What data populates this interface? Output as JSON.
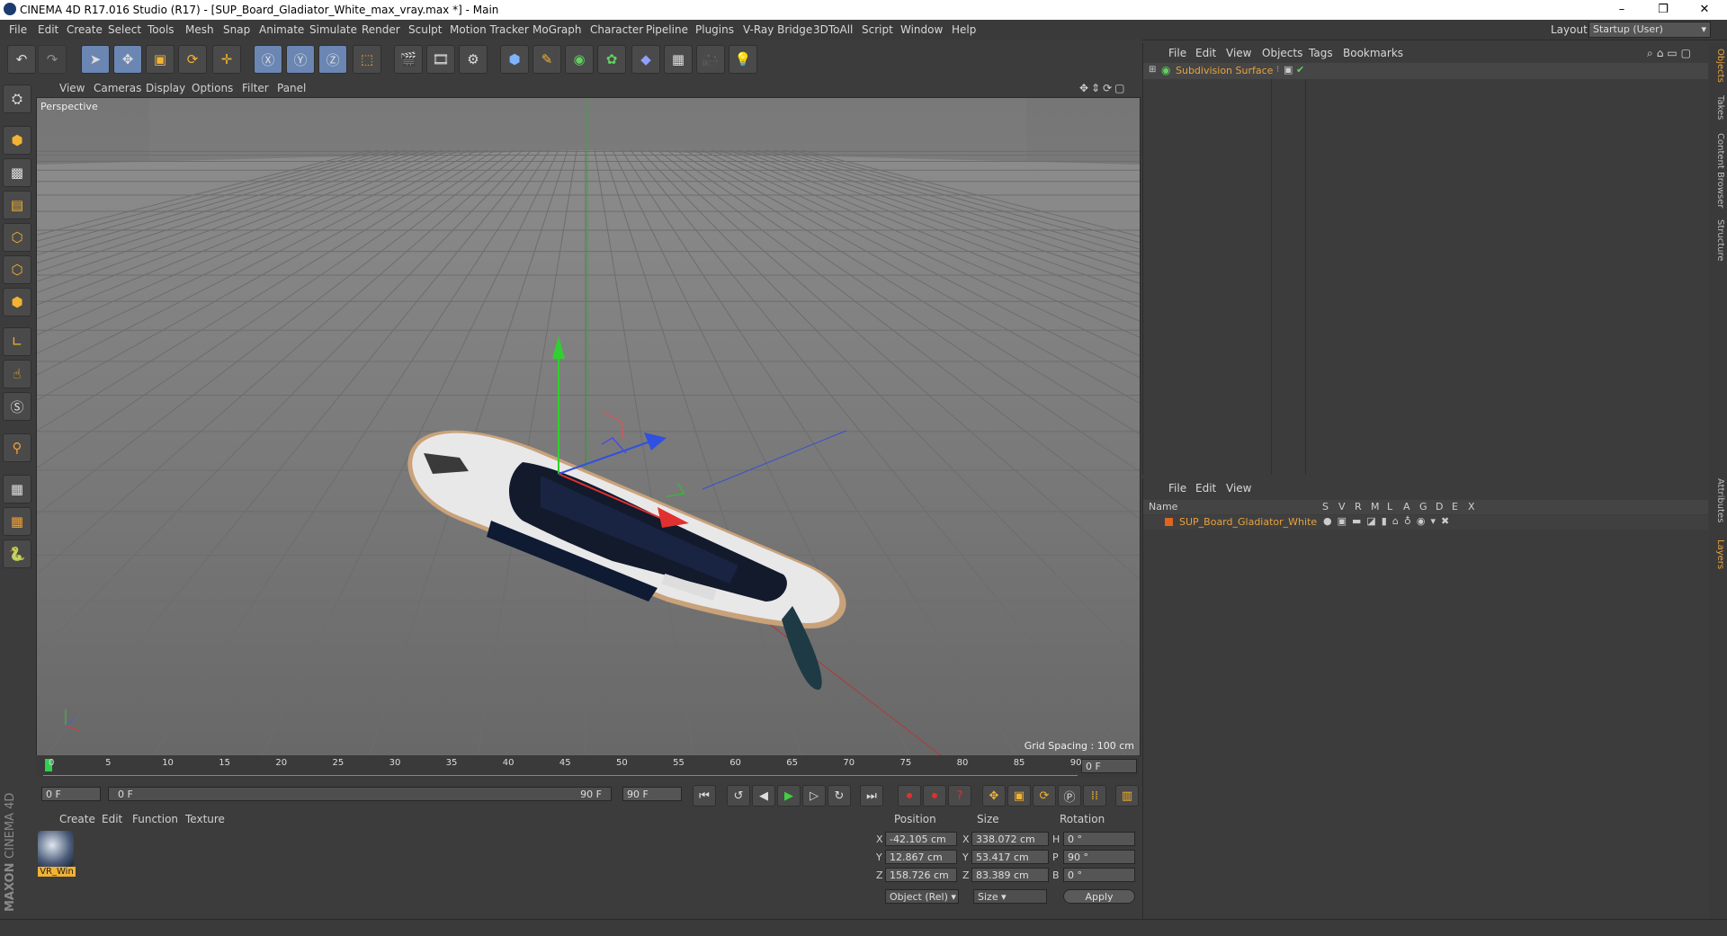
{
  "window": {
    "title": "CINEMA 4D R17.016 Studio (R17) - [SUP_Board_Gladiator_White_max_vray.max *] - Main",
    "controls": [
      "–",
      "❐",
      "✕"
    ]
  },
  "menu": [
    "File",
    "Edit",
    "Create",
    "Select",
    "Tools",
    "Mesh",
    "Snap",
    "Animate",
    "Simulate",
    "Render",
    "Sculpt",
    "Motion Tracker",
    "MoGraph",
    "Character",
    "Pipeline",
    "Plugins",
    "V-Ray Bridge",
    "3DToAll",
    "Script",
    "Window",
    "Help"
  ],
  "layout": {
    "label": "Layout:",
    "value": "Startup (User)"
  },
  "viewport": {
    "menu": [
      "View",
      "Cameras",
      "Display",
      "Options",
      "Filter",
      "Panel"
    ],
    "name": "Perspective",
    "grid_spacing": "Grid Spacing : 100 cm"
  },
  "timeline": {
    "ticks": [
      "0",
      "5",
      "10",
      "15",
      "20",
      "25",
      "30",
      "35",
      "40",
      "45",
      "50",
      "55",
      "60",
      "65",
      "70",
      "75",
      "80",
      "85",
      "90"
    ],
    "end_field": "0 F",
    "current": "0 F",
    "range_start": "0 F",
    "range_end": "90 F",
    "max": "90 F"
  },
  "material_manager": {
    "menu": [
      "Create",
      "Edit",
      "Function",
      "Texture"
    ],
    "materials": [
      {
        "name": "VR_Win"
      }
    ]
  },
  "coordinates": {
    "headers": [
      "Position",
      "Size",
      "Rotation"
    ],
    "rows": [
      {
        "axis": "X",
        "pos": "-42.105 cm",
        "size_axis": "X",
        "size": "338.072 cm",
        "rot_axis": "H",
        "rot": "0 °"
      },
      {
        "axis": "Y",
        "pos": "12.867 cm",
        "size_axis": "Y",
        "size": "53.417 cm",
        "rot_axis": "P",
        "rot": "90 °"
      },
      {
        "axis": "Z",
        "pos": "158.726 cm",
        "size_axis": "Z",
        "size": "83.389 cm",
        "rot_axis": "B",
        "rot": "0 °"
      }
    ],
    "mode": "Object (Rel)",
    "size_mode": "Size",
    "apply": "Apply"
  },
  "object_manager": {
    "menu": [
      "File",
      "Edit",
      "View",
      "Objects",
      "Tags",
      "Bookmarks"
    ],
    "objects": [
      {
        "name": "Subdivision Surface"
      }
    ]
  },
  "layer_manager": {
    "menu": [
      "File",
      "Edit",
      "View"
    ],
    "columns": {
      "name": "Name",
      "flags": [
        "S",
        "V",
        "R",
        "M",
        "L",
        "A",
        "G",
        "D",
        "E",
        "X"
      ]
    },
    "layers": [
      {
        "name": "SUP_Board_Gladiator_White"
      }
    ]
  },
  "side_tabs": [
    "Objects",
    "Takes",
    "Content Browser",
    "Structure",
    "Attributes",
    "Layers"
  ],
  "brand": {
    "line1": "MAXON",
    "line2": "CINEMA 4D"
  },
  "colors": {
    "accent_orange": "#e8a33d",
    "selection_blue": "#6b86b3",
    "viewport_bg": "#7a7a7a"
  }
}
